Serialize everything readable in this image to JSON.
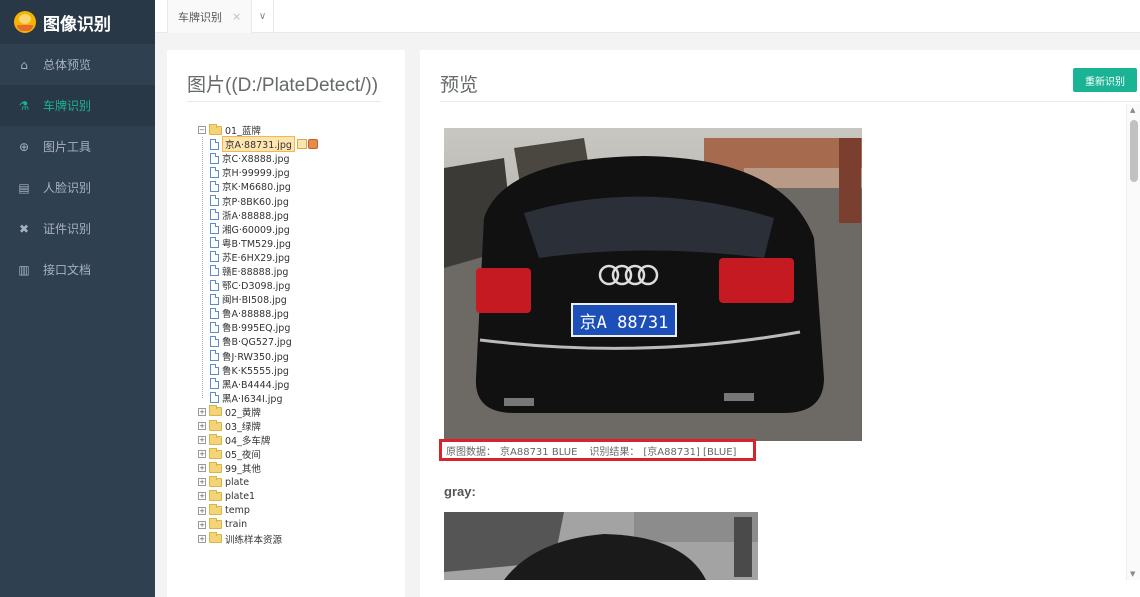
{
  "brand": {
    "title": "图像识别"
  },
  "sidebar": {
    "items": [
      {
        "label": "总体预览",
        "icon": "home-icon",
        "glyph": "⌂"
      },
      {
        "label": "车牌识别",
        "icon": "flask-icon",
        "glyph": "⚗",
        "active": true
      },
      {
        "label": "图片工具",
        "icon": "globe-icon",
        "glyph": "⊕"
      },
      {
        "label": "人脸识别",
        "icon": "id-card-icon",
        "glyph": "▤"
      },
      {
        "label": "证件识别",
        "icon": "tools-icon",
        "glyph": "✖"
      },
      {
        "label": "接口文档",
        "icon": "book-icon",
        "glyph": "▥"
      }
    ]
  },
  "tabs": [
    {
      "label": "车牌识别",
      "close": "×"
    }
  ],
  "tabs_dropdown": "∨",
  "left_panel": {
    "title": "图片((D:/PlateDetect/))"
  },
  "tree": {
    "expanded_folder": {
      "label": "01_蓝牌",
      "files": [
        "京A·88731.jpg",
        "京C·X8888.jpg",
        "京H·99999.jpg",
        "京K·M6680.jpg",
        "京P·8BK60.jpg",
        "浙A·88888.jpg",
        "湘G·60009.jpg",
        "粤B·TM529.jpg",
        "苏E·6HX29.jpg",
        "赣E·88888.jpg",
        "鄂C·D3098.jpg",
        "闽H·BI508.jpg",
        "鲁A·88888.jpg",
        "鲁B·995EQ.jpg",
        "鲁B·QG527.jpg",
        "鲁J·RW350.jpg",
        "鲁K·K5555.jpg",
        "黑A·B4444.jpg",
        "黑A·I634I.jpg"
      ],
      "selected_index": 0
    },
    "collapsed_folders": [
      "02_黄牌",
      "03_绿牌",
      "04_多车牌",
      "05_夜间",
      "99_其他",
      "plate",
      "plate1",
      "temp",
      "train",
      "训练样本资源"
    ],
    "toggle_open": "−",
    "toggle_closed": "+"
  },
  "right_panel": {
    "title": "预览",
    "redo_button": "重新识别",
    "caption": {
      "original_label": "原图数据：",
      "original_value": "京A88731 BLUE",
      "result_label": "识别结果：",
      "result_value": "[京A88731] [BLUE]"
    },
    "gray_title": "gray:",
    "plate_text": "京A 88731"
  },
  "scrollbar": {
    "up": "▲",
    "down": "▼"
  },
  "colors": {
    "sidebar": "#2f4050",
    "accent": "#1ab394",
    "highlight_border": "#d9232a"
  }
}
